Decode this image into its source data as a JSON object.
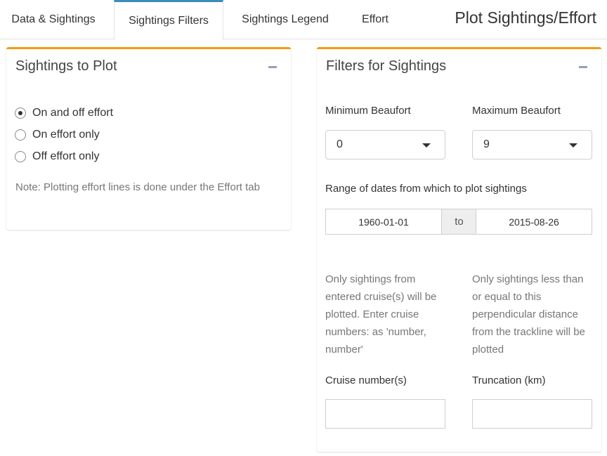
{
  "nav": {
    "tabs": [
      "Data & Sightings",
      "Sightings Filters",
      "Sightings Legend",
      "Effort"
    ],
    "active_tab": "Sightings Filters",
    "title": "Plot Sightings/Effort"
  },
  "colors": {
    "box_accent": "#f39c12",
    "tab_accent": "#3c8dbc"
  },
  "sightings_box": {
    "title": "Sightings to Plot",
    "options": [
      "On and off effort",
      "On effort only",
      "Off effort only"
    ],
    "selected": "On and off effort",
    "note": "Note: Plotting effort lines is done under the Effort tab"
  },
  "filters_box": {
    "title": "Filters for Sightings",
    "min_beaufort": {
      "label": "Minimum Beaufort",
      "value": "0"
    },
    "max_beaufort": {
      "label": "Maximum Beaufort",
      "value": "9"
    },
    "date_range": {
      "label": "Range of dates from which to plot sightings",
      "start": "1960-01-01",
      "separator": "to",
      "end": "2015-08-26"
    },
    "cruise": {
      "help": "Only sightings from entered cruise(s) will be plotted. Enter cruise numbers: as 'number, number'",
      "label": "Cruise number(s)",
      "value": ""
    },
    "truncation": {
      "help": "Only sightings less than or equal to this perpendicular distance from the trackline will be plotted",
      "label": "Truncation (km)",
      "value": ""
    }
  }
}
